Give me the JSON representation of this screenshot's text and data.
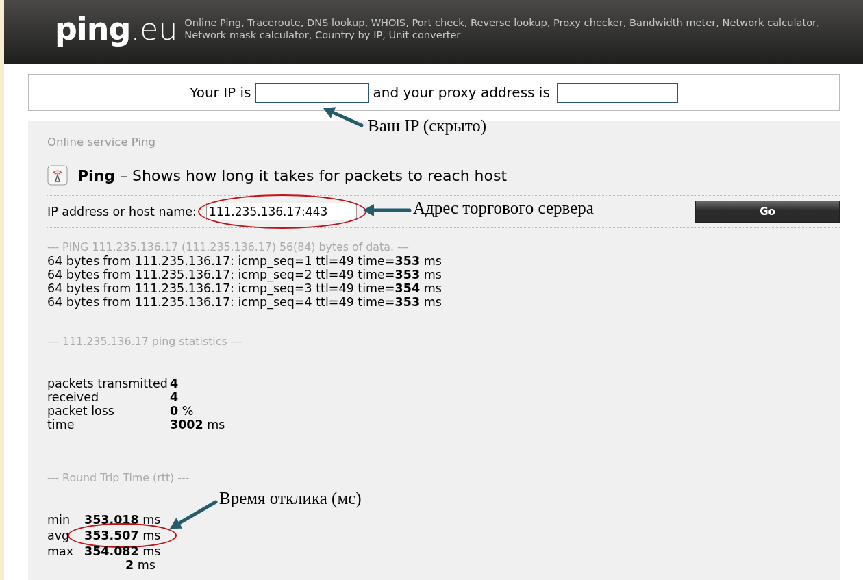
{
  "header": {
    "logo_main": "ping",
    "logo_suffix": ".eu",
    "tagline_lines": [
      "Online Ping, Traceroute, DNS lookup, WHOIS, Port check, Reverse lookup, Proxy checker, Bandwidth meter, Network calculator,",
      "Network mask calculator, Country by IP, Unit converter"
    ]
  },
  "ip_bar": {
    "ip_label": "Your IP is",
    "proxy_label": "and your proxy address is"
  },
  "service": {
    "breadcrumb": "Online service Ping",
    "title": "Ping",
    "subtitle": "– Shows how long it takes for packets to reach host",
    "host_label": "IP address or host name:",
    "host_value": "111.235.136.17:443",
    "go_button": "Go"
  },
  "output": {
    "ping_header": "--- PING 111.235.136.17 (111.235.136.17) 56(84) bytes of data. ---",
    "replies": [
      {
        "prefix": "64 bytes from 111.235.136.17: icmp_seq=1 ttl=49 time=",
        "time": "353",
        "unit": "ms"
      },
      {
        "prefix": "64 bytes from 111.235.136.17: icmp_seq=2 ttl=49 time=",
        "time": "353",
        "unit": "ms"
      },
      {
        "prefix": "64 bytes from 111.235.136.17: icmp_seq=3 ttl=49 time=",
        "time": "354",
        "unit": "ms"
      },
      {
        "prefix": "64 bytes from 111.235.136.17: icmp_seq=4 ttl=49 time=",
        "time": "353",
        "unit": "ms"
      }
    ],
    "stats_header": "--- 111.235.136.17 ping statistics ---",
    "stats": [
      {
        "label": "packets transmitted",
        "value": "4"
      },
      {
        "label": "received",
        "value": "4"
      },
      {
        "label": "packet loss",
        "value": "0",
        "unit": "%"
      },
      {
        "label": "time",
        "value": "3002",
        "unit": "ms"
      }
    ],
    "rtt_header": "--- Round Trip Time (rtt) ---",
    "rtt": [
      {
        "label": "min",
        "value": "353.018",
        "unit": "ms"
      },
      {
        "label": "avg",
        "value": "353.507",
        "unit": "ms"
      },
      {
        "label": "max",
        "value": "354.082",
        "unit": "ms"
      },
      {
        "value": "2",
        "unit": "ms"
      }
    ]
  },
  "annotations": [
    {
      "text": "Ваш IP (скрыто)"
    },
    {
      "text": "Адрес торгового сервера"
    },
    {
      "text": "Время отклика (мс)"
    }
  ]
}
